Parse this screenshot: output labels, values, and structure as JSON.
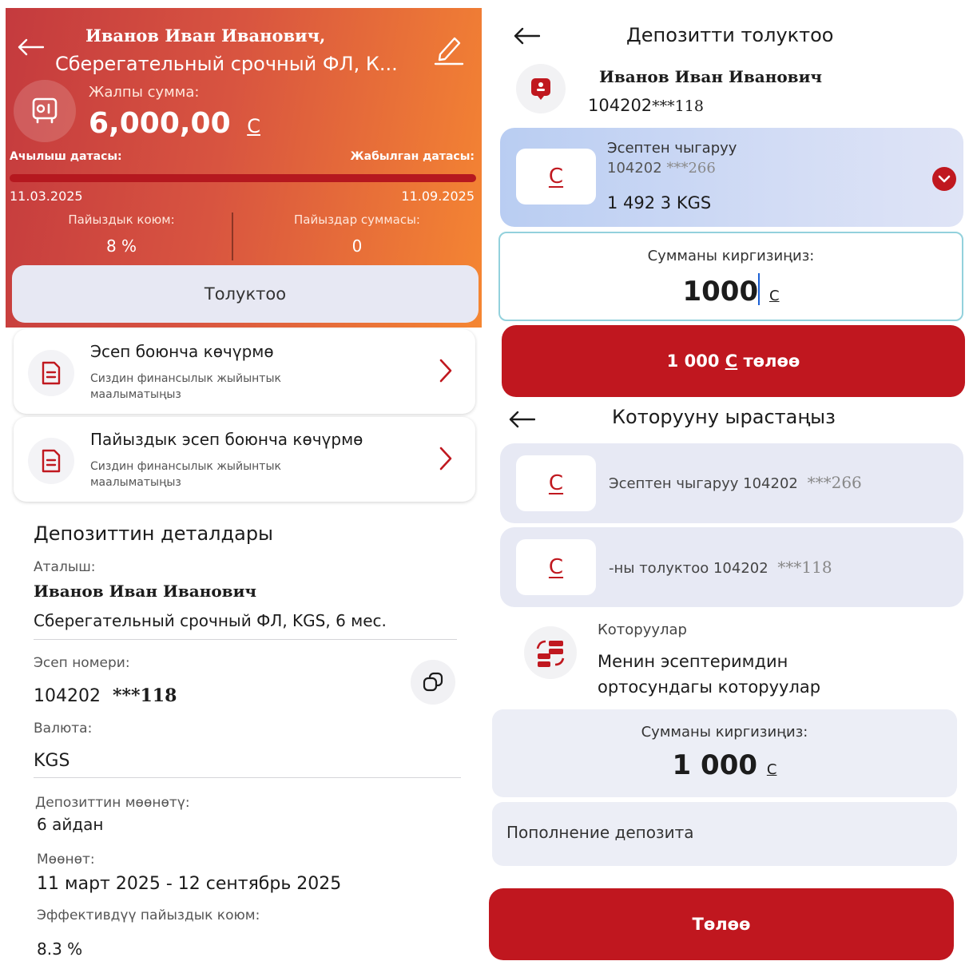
{
  "left": {
    "header": {
      "holder_name": "Иванов Иван Иванович,",
      "product_short": "Сберегательный срочный ФЛ, К...",
      "total_label": "Жалпы сумма:",
      "total_value": "6,000,00",
      "currency_symbol": "С",
      "open_date_label": "Ачылыш датасы:",
      "close_date_label": "Жабылган датасы:",
      "open_date": "11.03.2025",
      "close_date": "11.09.2025",
      "rate_label": "Пайыздык коюм:",
      "rate_value": "8 %",
      "interest_label": "Пайыздар суммасы:",
      "interest_value": "0",
      "topup_label": "Толуктоо",
      "term_progress": 0
    },
    "statements": [
      {
        "title": "Эсеп боюнча көчүрмө",
        "subtitle": "Сиздин финансылык жыйынтык маалыматыңыз"
      },
      {
        "title": "Пайыздык эсеп боюнча көчүрмө",
        "subtitle": "Сиздин финансылык жыйынтык маалыматыңыз"
      }
    ],
    "details": {
      "title": "Депозиттин деталдары",
      "name_label": "Аталыш:",
      "name_value": "Иванов Иван Иванович",
      "product_value": "Сберегательный срочный ФЛ, KGS, 6 мес.",
      "account_label": "Эсеп номери:",
      "account_prefix": "104202",
      "account_masked": "***118",
      "currency_label": "Валюта:",
      "currency_value": "KGS",
      "term_label": "Депозиттин мөөнөтү:",
      "term_value": "6 айдан",
      "period_label": "Мөөнөт:",
      "period_value": "11 март 2025 - 12 сентябрь 2025",
      "eff_rate_label": "Эффективдүү пайыздык коюм:",
      "eff_rate_value": "8.3 %"
    }
  },
  "right": {
    "topup": {
      "title": "Депозитти толуктоо",
      "holder_name": "Иванов Иван Иванович",
      "account_prefix": "104202",
      "account_masked": "***118",
      "debit_label": "Эсептен чыгаруу",
      "debit_account_prefix": "104202",
      "debit_account_masked": "***266",
      "balance": "1 492 3 KGS",
      "amount_label": "Сумманы киргизиңиз:",
      "amount_value": "1000",
      "pay_amount": "1 000",
      "pay_suffix": "төлөө",
      "currency_symbol": "С"
    },
    "confirm": {
      "title": "Которууну ырастаңыз",
      "from_text": "Эсептен чыгаруу 104202",
      "from_masked": "***266",
      "to_text": "-ны толуктоо 104202",
      "to_masked": "***118",
      "transfers_label": "Которуулар",
      "transfers_value_line1": "Менин эсептеримдин",
      "transfers_value_line2": "ортосундагы которуулар",
      "amount_label": "Сумманы киргизиңиз:",
      "amount_value": "1 000",
      "purpose": "Пополнение депозита",
      "pay_label": "Төлөө",
      "currency_symbol": "С"
    }
  }
}
